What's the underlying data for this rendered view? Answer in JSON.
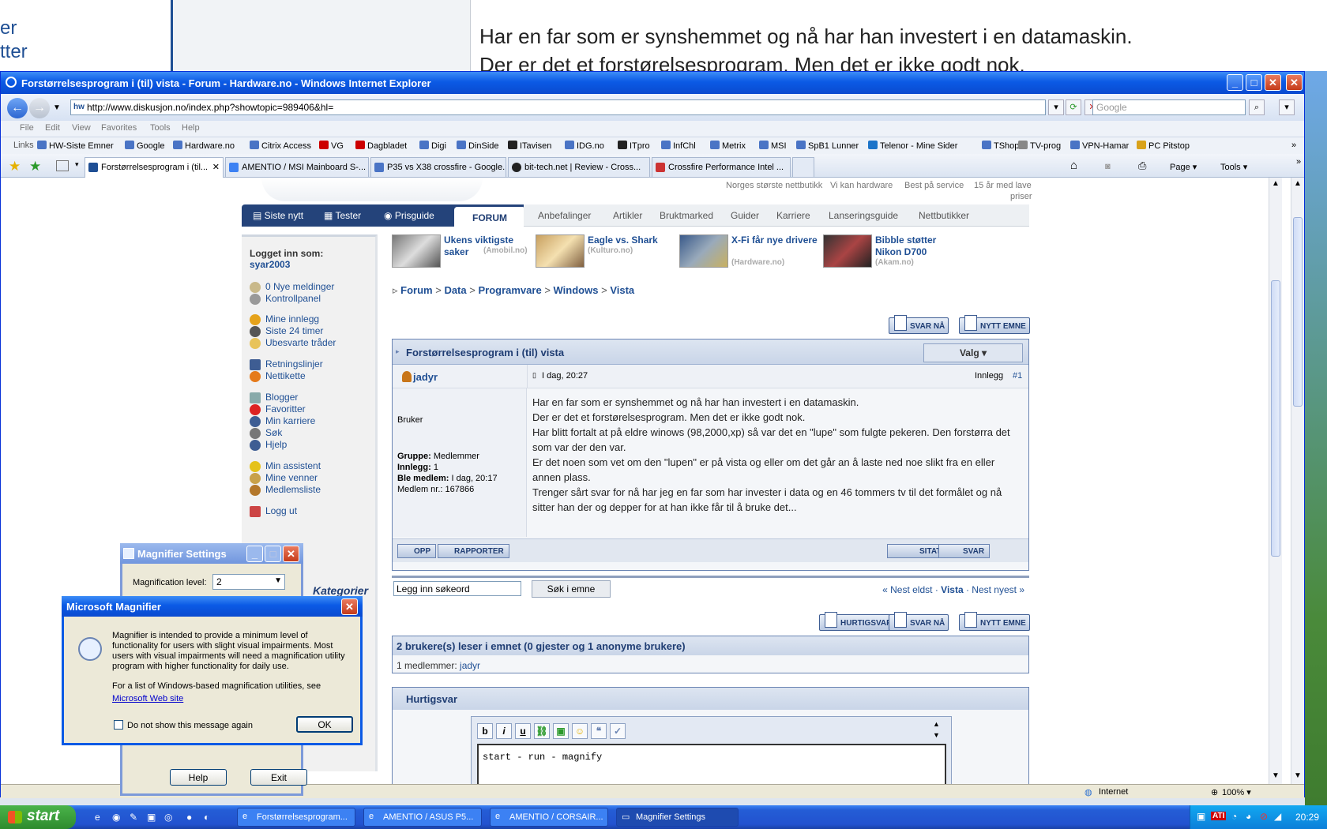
{
  "magnifier_strip": {
    "side_lines": [
      "er",
      "tter"
    ],
    "line1": "Har en far som er synshemmet og nå har han investert i en datamaskin.",
    "line2": "Der er det et forstørelsesprogram. Men det er ikke godt nok."
  },
  "ie": {
    "title": "Forstørrelsesprogram i (til) vista - Forum - Hardware.no - Windows Internet Explorer",
    "address": "http://www.diskusjon.no/index.php?showtopic=989406&hl=",
    "search_placeholder": "Google",
    "menu": [
      "File",
      "Edit",
      "View",
      "Favorites",
      "Tools",
      "Help"
    ],
    "links_label": "Links",
    "links": [
      "HW-Siste Emner",
      "Google",
      "Hardware.no",
      "Citrix Access",
      "VG",
      "Dagbladet",
      "Digi",
      "DinSide",
      "ITavisen",
      "IDG.no",
      "ITpro",
      "InfChl",
      "Metrix",
      "MSI",
      "SpB1 Lunner",
      "Telenor - Mine Sider",
      "TShop",
      "TV-prog",
      "VPN-Hamar",
      "PC Pitstop"
    ],
    "tabs": [
      "Forstørrelsesprogram i (til...",
      "AMENTIO / MSI Mainboard S-...",
      "P35 vs X38 crossfire - Google...",
      "bit-tech.net | Review - Cross...",
      "Crossfire Performance Intel ..."
    ],
    "cmd": {
      "page": "Page",
      "tools": "Tools"
    },
    "status": {
      "zone": "Internet",
      "zoom": "100%"
    }
  },
  "site": {
    "top_links": [
      "Norges største nettbutikk",
      "Vi kan hardware",
      "Best på service",
      "15 år med lave",
      "priser"
    ],
    "nav_dark": [
      "Siste nytt",
      "Tester",
      "Prisguide"
    ],
    "nav_active": "FORUM",
    "nav_light": [
      "Anbefalinger",
      "Artikler",
      "Bruktmarked",
      "Guider",
      "Karriere",
      "Lanseringsguide",
      "Nettbutikker"
    ],
    "promos": [
      {
        "title": "Ukens viktigste saker",
        "source": "(Amobil.no)"
      },
      {
        "title": "Eagle vs. Shark",
        "source": "(Kulturo.no)"
      },
      {
        "title": "X-Fi får nye drivere",
        "source": "(Hardware.no)"
      },
      {
        "title": "Bibble støtter Nikon D700",
        "source": "(Akam.no)"
      }
    ],
    "sidebar": {
      "logged_in_label": "Logget inn som:",
      "username": "syar2003",
      "links": [
        "0 Nye meldinger",
        "Kontrollpanel",
        "Mine innlegg",
        "Siste 24 timer",
        "Ubesvarte tråder",
        "Retningslinjer",
        "Nettikette",
        "Blogger",
        "Favoritter",
        "Min karriere",
        "Søk",
        "Hjelp",
        "Min assistent",
        "Mine venner",
        "Medlemsliste",
        "Logg ut"
      ],
      "kategorier": "Kategorier"
    },
    "breadcrumb": [
      "Forum",
      "Data",
      "Programvare",
      "Windows",
      "Vista"
    ],
    "buttons": {
      "svar_na": "SVAR NÅ",
      "nytt_emne": "NYTT EMNE",
      "hurtigsvar": "HURTIGSVAR"
    },
    "post": {
      "title": "Forstørrelsesprogram i (til) vista",
      "valg": "Valg",
      "author": "jadyr",
      "date": "I dag, 20:27",
      "innlegg_label": "Innlegg",
      "innlegg_num": "#1",
      "role": "Bruker",
      "gruppe_label": "Gruppe:",
      "gruppe": "Medlemmer",
      "innlegg_count_label": "Innlegg:",
      "innlegg_count": "1",
      "ble_label": "Ble medlem:",
      "ble": "I dag, 20:17",
      "medlem_nr": "Medlem nr.: 167866",
      "body": [
        "Har en far som er synshemmet og nå har han investert i en datamaskin.",
        "Der er det et forstørelsesprogram. Men det er ikke godt nok.",
        "Har blitt fortalt at på eldre winows (98,2000,xp) så var det en \"lupe\" som fulgte pekeren. Den forstørra det som var der den var.",
        "Er det noen som vet om den \"lupen\" er på vista og eller om det går an å laste ned noe slikt fra en eller annen plass.",
        "Trenger sårt svar for nå har jeg en far som har invester i data og en 46 tommers tv til det formålet og nå sitter han der og depper for at han ikke får til å bruke det..."
      ],
      "opp": "OPP",
      "rapporter": "RAPPORTER",
      "sitat": "SITAT",
      "svar": "SVAR"
    },
    "search": {
      "placeholder": "Legg inn søkeord",
      "button": "Søk i emne"
    },
    "pager": {
      "prev": "« Nest eldst",
      "mid": "Vista",
      "next": "Nest nyest »"
    },
    "readers": {
      "header": "2 brukere(s) leser i emnet (0 gjester og 1 anonyme brukere)",
      "label": "1 medlemmer:",
      "user": "jadyr"
    },
    "quick": {
      "header": "Hurtigsvar",
      "text": "start - run - magnify"
    }
  },
  "magset": {
    "title": "Magnifier Settings",
    "level_label": "Magnification level:",
    "level": "2",
    "help": "Help",
    "exit": "Exit"
  },
  "magdialog": {
    "title": "Microsoft Magnifier",
    "p1": "Magnifier is intended to provide a minimum level of functionality for users with slight visual impairments. Most users with visual impairments will need a magnification utility program with higher functionality for daily use.",
    "p2": "For a list of Windows-based magnification utilities, see",
    "link": "Microsoft Web site",
    "checkbox": "Do not show this message again",
    "ok": "OK"
  },
  "taskbar": {
    "start": "start",
    "items": [
      "Forstørrelsesprogram...",
      "AMENTIO / ASUS P5...",
      "AMENTIO / CORSAIR...",
      "Magnifier Settings"
    ],
    "time": "20:29"
  }
}
